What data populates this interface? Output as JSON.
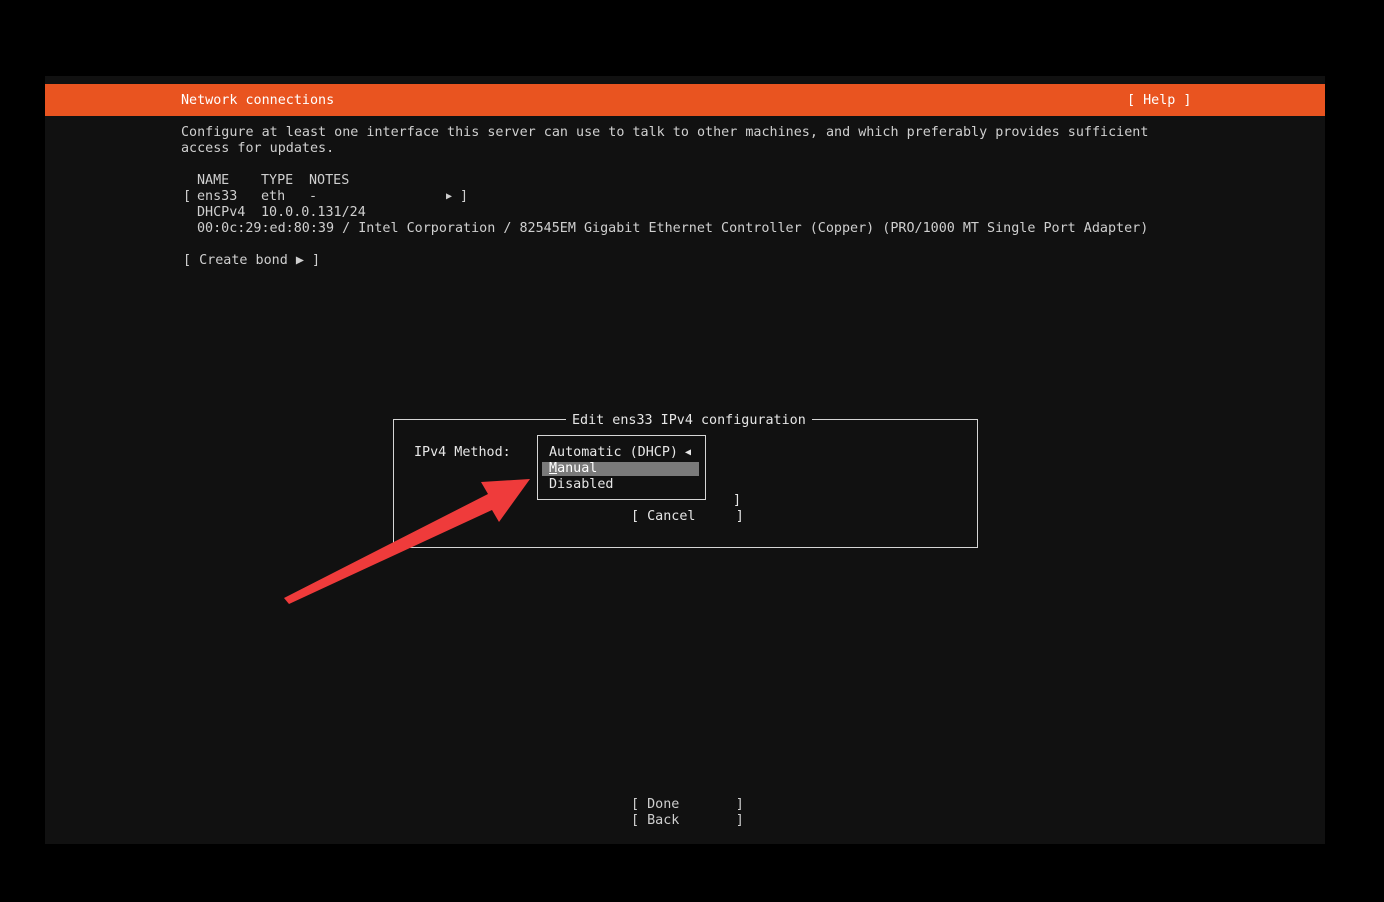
{
  "header": {
    "title": "Network connections",
    "help_label": "[ Help ]"
  },
  "intro": {
    "line1": "Configure at least one interface this server can use to talk to other machines, and which preferably provides sufficient",
    "line2": "access for updates."
  },
  "interfaces_table": {
    "columns": [
      "NAME",
      "TYPE",
      "NOTES"
    ],
    "rows": [
      {
        "bracket_open": "[",
        "name": "ens33",
        "type": "eth",
        "notes": "-",
        "menu_arrow": "▶",
        "bracket_close": "]",
        "dhcp_label": "DHCPv4",
        "address": "10.0.0.131/24",
        "hardware": "00:0c:29:ed:80:39 / Intel Corporation / 82545EM Gigabit Ethernet Controller (Copper) (PRO/1000 MT Single Port Adapter)"
      }
    ]
  },
  "create_bond": {
    "label": "[ Create bond ▶ ]"
  },
  "dialog": {
    "title": "Edit ens33 IPv4 configuration",
    "method_label": "IPv4 Method:",
    "dropdown": {
      "current": "Automatic (DHCP)",
      "current_arrow": "◀",
      "options": [
        "Manual",
        "Disabled"
      ],
      "highlighted": "Manual"
    },
    "save_bracket_close": "]",
    "cancel_label": "[ Cancel     ]"
  },
  "footer": {
    "done_label": "[ Done       ]",
    "back_label": "[ Back       ]"
  },
  "colors": {
    "accent": "#e95420",
    "background": "#111111",
    "annotation_arrow": "#ef3b3b",
    "highlight": "#7a7a7a"
  }
}
